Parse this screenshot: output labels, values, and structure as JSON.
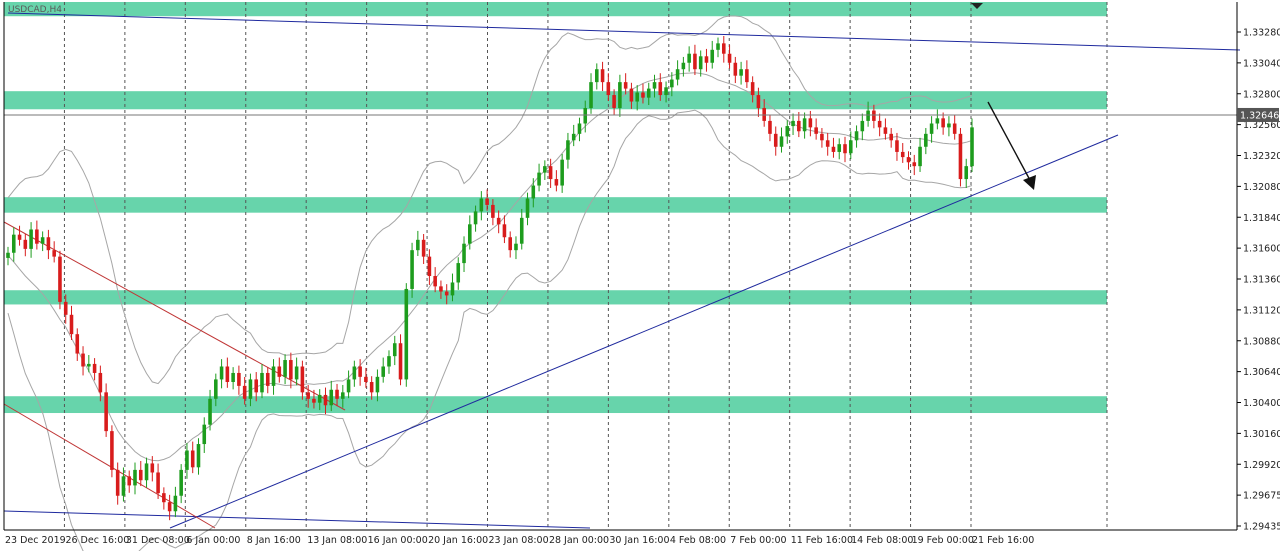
{
  "chart_data": {
    "type": "candlestick",
    "title": "",
    "symbol_label": "USDCAD,H4",
    "xlabel": "",
    "ylabel": "",
    "ylim": [
      1.29435,
      1.3352
    ],
    "grid": {
      "vertical": true,
      "style": "dotted",
      "horizontal": false
    },
    "y_ticks": [
      "1.33280",
      "1.33040",
      "1.32800",
      "1.32560",
      "1.32320",
      "1.32080",
      "1.31840",
      "1.31600",
      "1.31360",
      "1.31120",
      "1.30880",
      "1.30640",
      "1.30400",
      "1.30160",
      "1.29920",
      "1.29675",
      "1.29435"
    ],
    "x_ticks": [
      "23 Dec 2019",
      "26 Dec 16:00",
      "31 Dec 08:00",
      "6 Jan 00:00",
      "8 Jan 16:00",
      "13 Jan 08:00",
      "16 Jan 00:00",
      "20 Jan 16:00",
      "23 Jan 08:00",
      "28 Jan 00:00",
      "30 Jan 16:00",
      "4 Feb 08:00",
      "7 Feb 00:00",
      "11 Feb 16:00",
      "14 Feb 08:00",
      "19 Feb 00:00",
      "21 Feb 16:00"
    ],
    "current_price": "1.32646",
    "bar_count": 168,
    "closes": [
      1.3158,
      1.3172,
      1.3168,
      1.3161,
      1.3176,
      1.3165,
      1.317,
      1.316,
      1.3155,
      1.312,
      1.311,
      1.3095,
      1.308,
      1.307,
      1.3072,
      1.3065,
      1.305,
      1.302,
      1.299,
      1.297,
      1.2985,
      1.2978,
      1.299,
      1.2982,
      1.2995,
      1.2988,
      1.2972,
      1.2965,
      1.2958,
      1.297,
      1.299,
      1.3005,
      1.2992,
      1.301,
      1.3025,
      1.3045,
      1.306,
      1.307,
      1.3058,
      1.3065,
      1.3055,
      1.3045,
      1.306,
      1.305,
      1.3065,
      1.3055,
      1.307,
      1.3062,
      1.3075,
      1.306,
      1.307,
      1.305,
      1.3045,
      1.3042,
      1.3048,
      1.304,
      1.3052,
      1.3045,
      1.305,
      1.306,
      1.307,
      1.3062,
      1.3058,
      1.305,
      1.3062,
      1.307,
      1.3078,
      1.3088,
      1.306,
      1.313,
      1.316,
      1.3168,
      1.3155,
      1.314,
      1.3132,
      1.3128,
      1.3125,
      1.3135,
      1.315,
      1.3165,
      1.318,
      1.319,
      1.32,
      1.3195,
      1.3185,
      1.318,
      1.317,
      1.316,
      1.3165,
      1.3185,
      1.32,
      1.321,
      1.322,
      1.3225,
      1.3215,
      1.321,
      1.323,
      1.3245,
      1.325,
      1.3258,
      1.327,
      1.329,
      1.33,
      1.329,
      1.328,
      1.327,
      1.329,
      1.3285,
      1.3275,
      1.3282,
      1.3278,
      1.3285,
      1.329,
      1.328,
      1.3286,
      1.3292,
      1.33,
      1.3305,
      1.3312,
      1.33,
      1.331,
      1.3305,
      1.3315,
      1.332,
      1.3312,
      1.3305,
      1.3295,
      1.33,
      1.329,
      1.328,
      1.327,
      1.326,
      1.325,
      1.324,
      1.3248,
      1.3256,
      1.326,
      1.3252,
      1.3262,
      1.3255,
      1.325,
      1.3245,
      1.324,
      1.3236,
      1.3242,
      1.3235,
      1.3245,
      1.3252,
      1.326,
      1.3268,
      1.326,
      1.3255,
      1.325,
      1.3245,
      1.3236,
      1.3232,
      1.3228,
      1.3225,
      1.324,
      1.325,
      1.3258,
      1.3262,
      1.3255,
      1.3258,
      1.325,
      1.3215,
      1.3225,
      1.3255
    ],
    "support_resistance_zones": [
      {
        "low": 1.3341,
        "high": 1.3352
      },
      {
        "low": 1.3269,
        "high": 1.3283
      },
      {
        "low": 1.3189,
        "high": 1.3201
      },
      {
        "low": 1.3118,
        "high": 1.3129
      },
      {
        "low": 1.3034,
        "high": 1.3047
      }
    ],
    "colors": {
      "bull": "#1d9c1d",
      "bear": "#d81c1c",
      "zone": "#3cc893",
      "trendline": "#1f2a9e",
      "channel": "#c03636",
      "bollinger": "#a6a6a6",
      "grid": "#555555",
      "price_tag": "#555555",
      "arrow": "#111111"
    }
  }
}
